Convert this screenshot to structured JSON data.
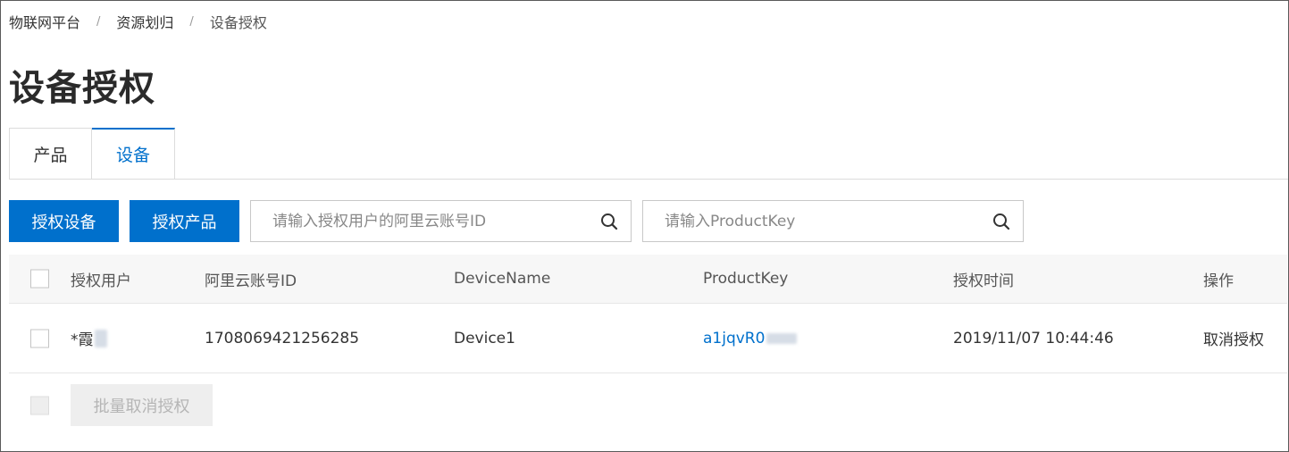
{
  "breadcrumb": {
    "items": [
      "物联网平台",
      "资源划归",
      "设备授权"
    ],
    "separator": "/"
  },
  "page_title": "设备授权",
  "tabs": [
    {
      "label": "产品",
      "active": false
    },
    {
      "label": "设备",
      "active": true
    }
  ],
  "toolbar": {
    "authorize_device_label": "授权设备",
    "authorize_product_label": "授权产品",
    "user_search_placeholder": "请输入授权用户的阿里云账号ID",
    "productkey_search_placeholder": "请输入ProductKey"
  },
  "table": {
    "columns": [
      "授权用户",
      "阿里云账号ID",
      "DeviceName",
      "ProductKey",
      "授权时间",
      "操作"
    ],
    "rows": [
      {
        "user": "*霞",
        "account_id": "1708069421256285",
        "device_name": "Device1",
        "product_key": "a1jqvR0",
        "auth_time": "2019/11/07 10:44:46",
        "action": "取消授权"
      }
    ]
  },
  "footer": {
    "batch_cancel_label": "批量取消授权"
  },
  "colors": {
    "primary": "#0070cc",
    "disabled_bg": "#eeeeee",
    "disabled_text": "#b5b5b5"
  },
  "icons": [
    "search-icon"
  ]
}
